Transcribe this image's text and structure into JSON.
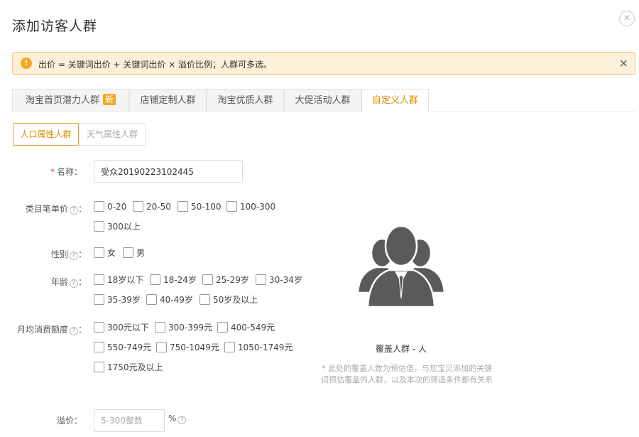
{
  "dialog": {
    "title": "添加访客人群",
    "close_symbol": "×"
  },
  "alert": {
    "icon": "!",
    "text": "出价 = 关键词出价 + 关键词出价 × 溢价比例；人群可多选。",
    "close_symbol": "×"
  },
  "tabs": [
    {
      "label": "淘宝首页潜力人群",
      "badge": "新"
    },
    {
      "label": "店铺定制人群"
    },
    {
      "label": "淘宝优质人群"
    },
    {
      "label": "大促活动人群"
    },
    {
      "label": "自定义人群",
      "active": true
    }
  ],
  "subtabs": [
    {
      "label": "人口属性人群",
      "active": true
    },
    {
      "label": "天气属性人群"
    }
  ],
  "form": {
    "name": {
      "required_mark": "*",
      "label": "名称：",
      "value": "受众20190223102445"
    },
    "price": {
      "label": "类目笔单价",
      "colon": "：",
      "options": [
        "0-20",
        "20-50",
        "50-100",
        "100-300",
        "300以上"
      ]
    },
    "gender": {
      "label": "性别",
      "colon": "：",
      "options": [
        "女",
        "男"
      ]
    },
    "age": {
      "label": "年龄",
      "colon": "：",
      "options": [
        "18岁以下",
        "18-24岁",
        "25-29岁",
        "30-34岁",
        "35-39岁",
        "40-49岁",
        "50岁及以上"
      ]
    },
    "spend": {
      "label": "月均消费额度",
      "colon": "：",
      "options": [
        "300元以下",
        "300-399元",
        "400-549元",
        "550-749元",
        "750-1049元",
        "1050-1749元",
        "1750元及以上"
      ]
    },
    "premium": {
      "label": "溢价：",
      "placeholder": "5-300整数",
      "unit": "%"
    },
    "help_symbol": "?"
  },
  "coverage": {
    "text": "覆盖人群 - 人",
    "note": "* 此处的覆盖人数为预估值，与您宝贝添加的关键词预估覆盖的人群，以及本次的筛选条件都有关系"
  },
  "icons": {
    "close": "close-icon",
    "alert": "exclamation-icon",
    "help": "question-icon",
    "people": "people-group-icon"
  },
  "colors": {
    "accent": "#e08a00",
    "alert_bg": "#fdf0d8",
    "alert_border": "#f2c778",
    "badge": "#f5a623",
    "icon_gray": "#5a5a5a"
  }
}
